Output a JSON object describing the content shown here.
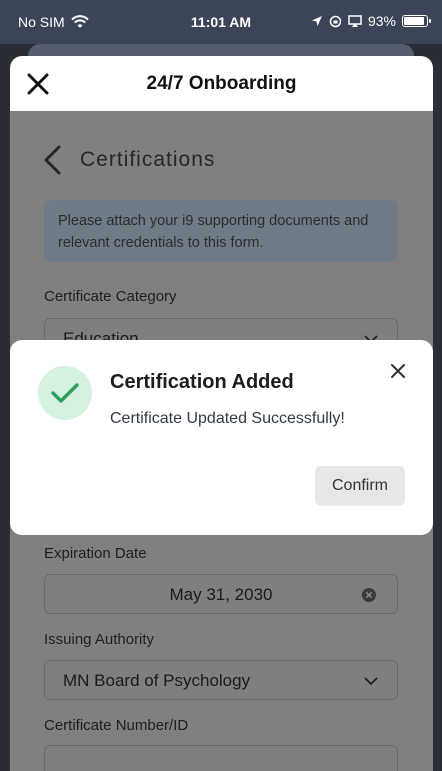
{
  "status_bar": {
    "carrier": "No SIM",
    "time": "11:01 AM",
    "battery": "93%"
  },
  "sheet": {
    "title": "24/7 Onboarding"
  },
  "page": {
    "title": "Certifications",
    "info": "Please attach your i9 supporting documents and relevant credentials to this form."
  },
  "fields": {
    "category_label": "Certificate Category",
    "category_value": "Education",
    "expiration_label": "Expiration Date",
    "expiration_value": "May 31, 2030",
    "authority_label": "Issuing Authority",
    "authority_value": "MN Board of Psychology",
    "number_label": "Certificate Number/ID"
  },
  "modal": {
    "title": "Certification Added",
    "message": "Certificate Updated Successfully!",
    "confirm_label": "Confirm"
  },
  "colors": {
    "success": "#2e9e5b",
    "success_bg": "#d5f2e0",
    "status_bar": "#3c4457"
  }
}
